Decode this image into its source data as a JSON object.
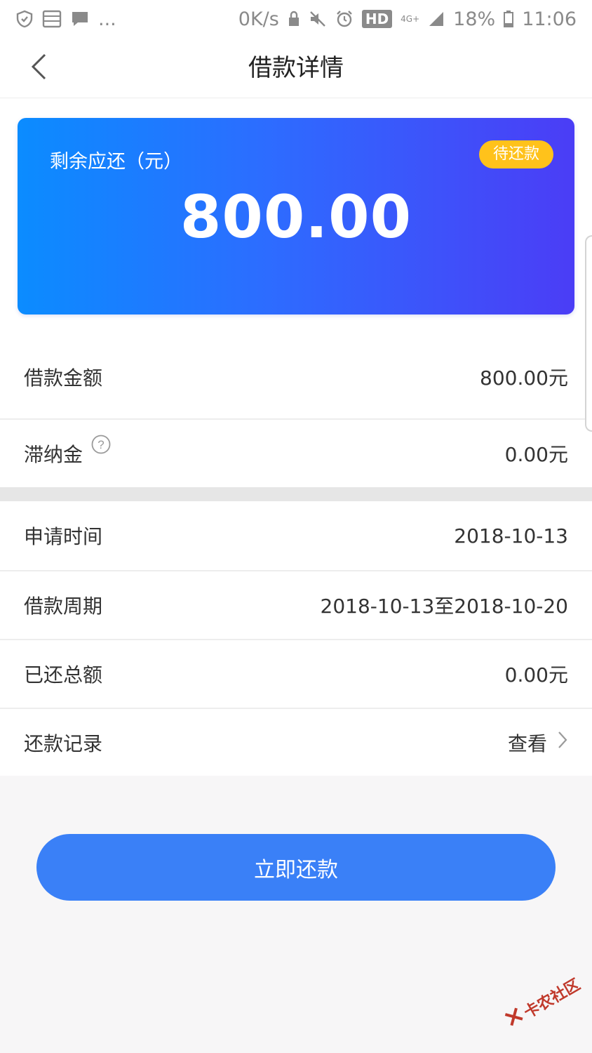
{
  "status_bar": {
    "more": "...",
    "speed": "0K/s",
    "hd": "HD",
    "network": "4G+",
    "battery_percent": "18%",
    "time": "11:06"
  },
  "header": {
    "title": "借款详情"
  },
  "card": {
    "label": "剩余应还（元）",
    "status": "待还款",
    "amount": "800.00"
  },
  "details": {
    "loan_amount_label": "借款金额",
    "loan_amount_value": "800.00元",
    "late_fee_label": "滞纳金",
    "late_fee_value": "0.00元",
    "apply_time_label": "申请时间",
    "apply_time_value": "2018-10-13",
    "period_label": "借款周期",
    "period_value": "2018-10-13至2018-10-20",
    "repaid_label": "已还总额",
    "repaid_value": "0.00元",
    "records_label": "还款记录",
    "records_link": "查看"
  },
  "actions": {
    "pay_button": "立即还款"
  },
  "watermark": {
    "text": "卡农社区"
  },
  "colors": {
    "card_gradient_start": "#0b8cff",
    "card_gradient_end": "#4b3df6",
    "badge": "#ffc21b",
    "button": "#3a80f7"
  }
}
